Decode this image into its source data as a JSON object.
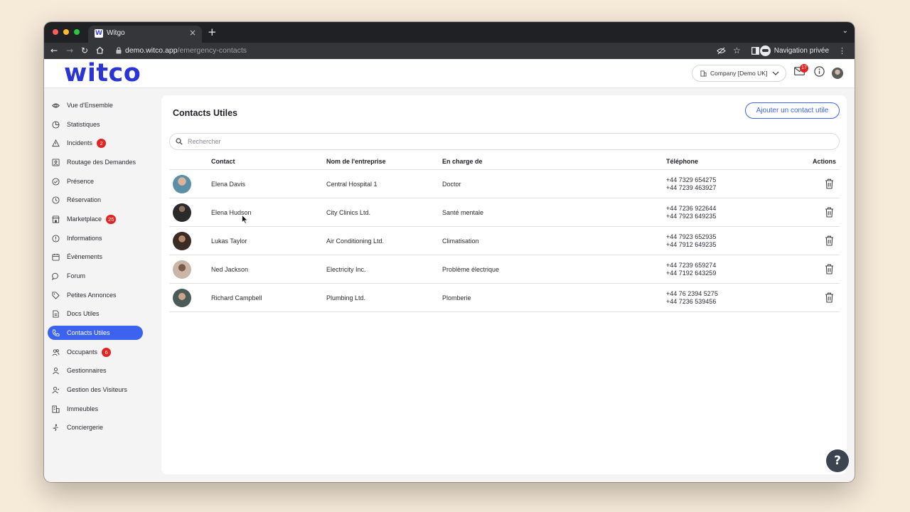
{
  "browser": {
    "tab_title": "Witgo",
    "tab_close": "×",
    "new_tab": "+",
    "tab_menu": "⌄",
    "url_host": "demo.witco.app",
    "url_path": "/emergency-contacts",
    "private_label": "Navigation privée",
    "traffic_light_colors": [
      "#ff5f57",
      "#febc2e",
      "#28c840"
    ]
  },
  "header": {
    "logo": "witco",
    "company_select": "Company [Demo UK]",
    "mail_badge": "17",
    "accent_color": "#3c63f0"
  },
  "sidebar": {
    "items": [
      {
        "label": "Vue d'Ensemble",
        "icon": "eye-icon",
        "badge": ""
      },
      {
        "label": "Statistiques",
        "icon": "pie-chart-icon",
        "badge": ""
      },
      {
        "label": "Incidents",
        "icon": "warning-icon",
        "badge": "2"
      },
      {
        "label": "Routage des Demandes",
        "icon": "routing-icon",
        "badge": ""
      },
      {
        "label": "Présence",
        "icon": "check-circle-icon",
        "badge": ""
      },
      {
        "label": "Réservation",
        "icon": "clock-icon",
        "badge": ""
      },
      {
        "label": "Marketplace",
        "icon": "store-icon",
        "badge": "25"
      },
      {
        "label": "Informations",
        "icon": "info-icon",
        "badge": ""
      },
      {
        "label": "Évènements",
        "icon": "calendar-icon",
        "badge": ""
      },
      {
        "label": "Forum",
        "icon": "chat-icon",
        "badge": ""
      },
      {
        "label": "Petites Annonces",
        "icon": "tag-icon",
        "badge": ""
      },
      {
        "label": "Docs Utiles",
        "icon": "document-icon",
        "badge": ""
      },
      {
        "label": "Contacts Utiles",
        "icon": "phone-icon",
        "badge": "",
        "active": true
      },
      {
        "label": "Occupants",
        "icon": "users-icon",
        "badge": "6"
      },
      {
        "label": "Gestionnaires",
        "icon": "user-icon",
        "badge": ""
      },
      {
        "label": "Gestion des Visiteurs",
        "icon": "visitor-icon",
        "badge": ""
      },
      {
        "label": "Immeubles",
        "icon": "building-icon",
        "badge": ""
      },
      {
        "label": "Conciergerie",
        "icon": "concierge-icon",
        "badge": ""
      }
    ]
  },
  "main": {
    "title": "Contacts Utiles",
    "add_button": "Ajouter un contact utile",
    "search_placeholder": "Rechercher",
    "columns": {
      "contact": "Contact",
      "company": "Nom de l'entreprise",
      "in_charge": "En charge de",
      "phone": "Téléphone",
      "actions": "Actions"
    },
    "rows": [
      {
        "name": "Elena Davis",
        "company": "Central Hospital 1",
        "in_charge": "Doctor",
        "phone1": "+44 7329 654275",
        "phone2": "+44 7239 463927",
        "avatar_color": "#5b8fa8"
      },
      {
        "name": "Elena Hudson",
        "company": "City Clinics Ltd.",
        "in_charge": "Santé mentale",
        "phone1": "+44 7236 922644",
        "phone2": "+44 7923 649235",
        "avatar_color": "#2a2a2a"
      },
      {
        "name": "Lukas Taylor",
        "company": "Air Conditioning Ltd.",
        "in_charge": "Climatisation",
        "phone1": "+44 7923 652935",
        "phone2": "+44 7912 649235",
        "avatar_color": "#3a2c24"
      },
      {
        "name": "Ned Jackson",
        "company": "Electricity Inc.",
        "in_charge": "Problème électrique",
        "phone1": "+44 7239 659274",
        "phone2": "+44 7192 643259",
        "avatar_color": "#c9b6a6"
      },
      {
        "name": "Richard Campbell",
        "company": "Plumbing Ltd.",
        "in_charge": "Plomberie",
        "phone1": "+44 76 2394 5275",
        "phone2": "+44 7236 539456",
        "avatar_color": "#4c5a58"
      }
    ]
  },
  "help_button": "?"
}
